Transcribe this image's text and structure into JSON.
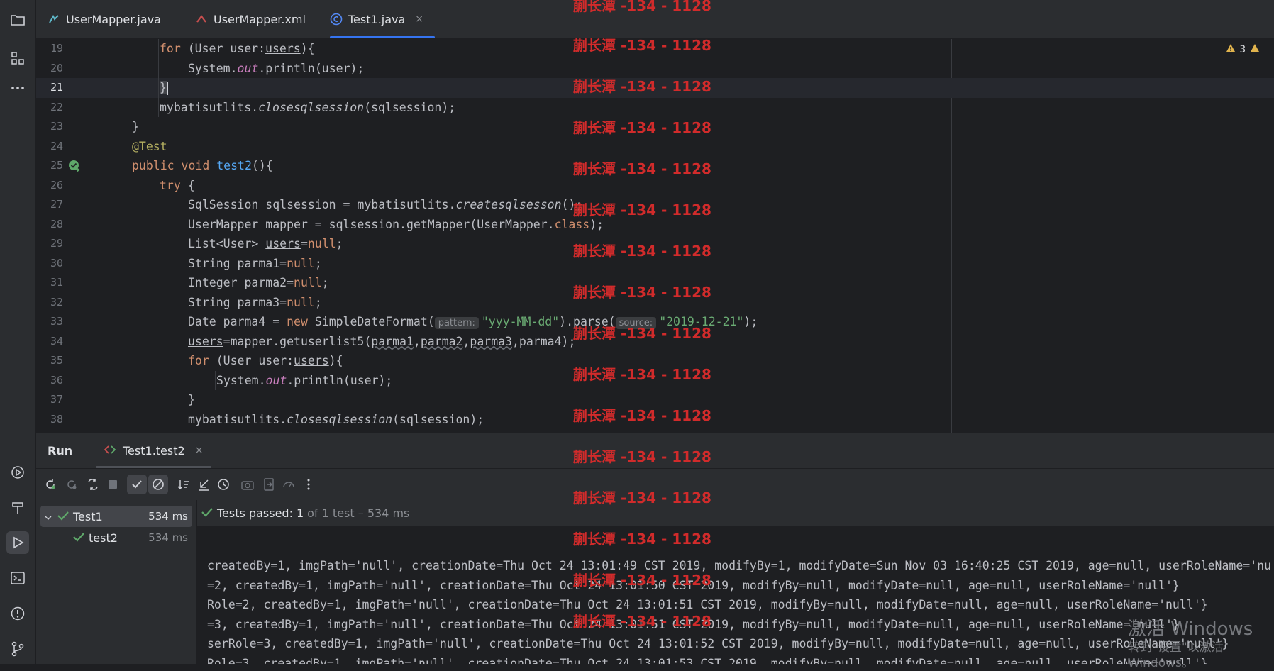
{
  "tabs": [
    {
      "label": "UserMapper.java",
      "icon": "java-interface-icon"
    },
    {
      "label": "UserMapper.xml",
      "icon": "xml-mapper-icon"
    },
    {
      "label": "Test1.java",
      "icon": "java-class-icon",
      "active": true,
      "close": "×"
    }
  ],
  "editor": {
    "warnings": "3",
    "lines": [
      {
        "n": "19"
      },
      {
        "n": "20"
      },
      {
        "n": "21"
      },
      {
        "n": "22"
      },
      {
        "n": "23"
      },
      {
        "n": "24"
      },
      {
        "n": "25"
      },
      {
        "n": "26"
      },
      {
        "n": "27"
      },
      {
        "n": "28"
      },
      {
        "n": "29"
      },
      {
        "n": "30"
      },
      {
        "n": "31"
      },
      {
        "n": "32"
      },
      {
        "n": "33"
      },
      {
        "n": "34"
      },
      {
        "n": "35"
      },
      {
        "n": "36"
      },
      {
        "n": "37"
      },
      {
        "n": "38"
      }
    ],
    "code": {
      "l19": [
        "for",
        " (User user:",
        "users",
        "){"
      ],
      "l20": [
        "System.",
        "out",
        ".println(user);"
      ],
      "l21": [
        "}"
      ],
      "l22": [
        "mybatisutlits.",
        "closesqlsession",
        "(sqlsession);"
      ],
      "l23": [
        "}"
      ],
      "l24": [
        "@Test"
      ],
      "l25": [
        "public",
        " ",
        "void",
        " ",
        "test2",
        "(){"
      ],
      "l26": [
        "try",
        " {"
      ],
      "l27": [
        "SqlSession sqlsession = mybatisutlits.",
        "createsqlsesson",
        "();"
      ],
      "l28": [
        "UserMapper mapper = sqlsession.getMapper(UserMapper.",
        "class",
        ");"
      ],
      "l29": [
        "List<User> ",
        "users",
        "=",
        "null",
        ";"
      ],
      "l30": [
        "String parma1=",
        "null",
        ";"
      ],
      "l31": [
        "Integer parma2=",
        "null",
        ";"
      ],
      "l32": [
        "String parma3=",
        "null",
        ";"
      ],
      "l33": [
        "Date parma4 = ",
        "new",
        " SimpleDateFormat(",
        "pattern:",
        "\"yyy-MM-dd\"",
        ").parse(",
        "source:",
        "\"2019-12-21\"",
        ");"
      ],
      "l34": [
        "users",
        "=mapper.getuserlist5(",
        "parma1",
        ",",
        "parma2",
        ",",
        "parma3",
        ",parma4);"
      ],
      "l35": [
        "for",
        " (User user:",
        "users",
        "){"
      ],
      "l36": [
        "System.",
        "out",
        ".println(user);"
      ],
      "l37": [
        "}"
      ],
      "l38": [
        "mybatisutlits.",
        "closesqlsession",
        "(sqlsession);"
      ]
    }
  },
  "watermark": "蒯长潭 -134 - 1128",
  "run": {
    "title": "Run",
    "config_tab": "Test1.test2",
    "close": "×",
    "status_prefix": "Tests passed:",
    "status_count": "1",
    "status_rest": "of 1 test – 534 ms",
    "tree": [
      {
        "label": "Test1",
        "time": "534 ms"
      },
      {
        "label": "test2",
        "time": "534 ms"
      }
    ],
    "console": [
      "createdBy=1, imgPath='null', creationDate=Thu Oct 24 13:01:49 CST 2019, modifyBy=1, modifyDate=Sun Nov 03 16:40:25 CST 2019, age=null, userRoleName='nu",
      "=2, createdBy=1, imgPath='null', creationDate=Thu Oct 24 13:01:50 CST 2019, modifyBy=null, modifyDate=null, age=null, userRoleName='null'}",
      "Role=2, createdBy=1, imgPath='null', creationDate=Thu Oct 24 13:01:51 CST 2019, modifyBy=null, modifyDate=null, age=null, userRoleName='null'}",
      "=3, createdBy=1, imgPath='null', creationDate=Thu Oct 24 13:01:51 CST 2019, modifyBy=null, modifyDate=null, age=null, userRoleName='null'}",
      "serRole=3, createdBy=1, imgPath='null', creationDate=Thu Oct 24 13:01:52 CST 2019, modifyBy=null, modifyDate=null, age=null, userRoleName='null'}",
      "Role=3, createdBy=1, imgPath='null', creationDate=Thu Oct 24 13:01:53 CST 2019, modifyBy=null, modifyDate=null, age=null, userRoleName='null'}"
    ]
  },
  "activation": {
    "line1": "激活 Windows",
    "line2": "转到\"设置\"以激活 Windows。"
  }
}
